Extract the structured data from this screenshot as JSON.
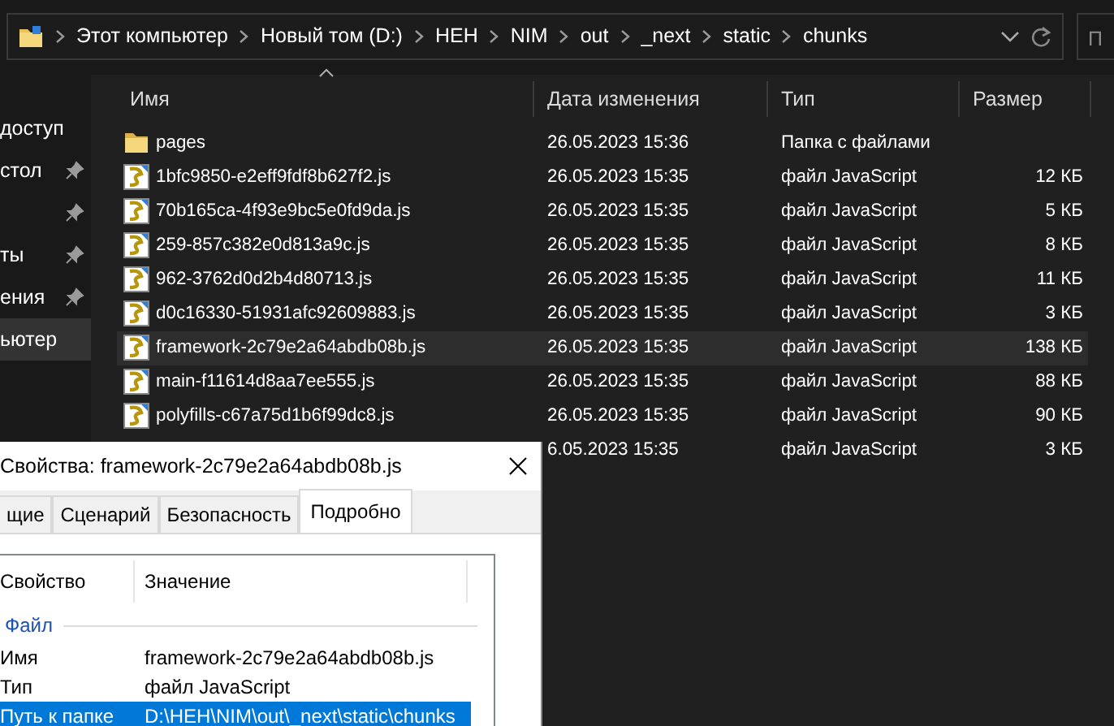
{
  "address_bar": {
    "crumbs": [
      "Этот компьютер",
      "Новый том (D:)",
      "HEH",
      "NIM",
      "out",
      "_next",
      "static",
      "chunks"
    ]
  },
  "search": {
    "placeholder": "П"
  },
  "sidebar": {
    "items": [
      {
        "label": "доступ",
        "pinned": false,
        "selected": false
      },
      {
        "label": "стол",
        "pinned": true,
        "selected": false
      },
      {
        "pinned": true,
        "selected": false
      },
      {
        "label": "ты",
        "pinned": true,
        "selected": false
      },
      {
        "label": "ения",
        "pinned": true,
        "selected": false
      },
      {
        "label": "ьютер",
        "pinned": false,
        "selected": true
      }
    ]
  },
  "file_list": {
    "columns": [
      {
        "label": "Имя",
        "sorted": true
      },
      {
        "label": "Дата изменения",
        "sorted": false
      },
      {
        "label": "Тип",
        "sorted": false
      },
      {
        "label": "Размер",
        "sorted": false
      }
    ],
    "rows": [
      {
        "kind": "folder",
        "name": "pages",
        "date": "26.05.2023 15:36",
        "type": "Папка с файлами",
        "selected": false
      },
      {
        "kind": "script",
        "name": "1bfc9850-e2eff9fdf8b627f2.js",
        "date": "26.05.2023 15:35",
        "type": "файл JavaScript",
        "size": "12 КБ",
        "selected": false
      },
      {
        "kind": "script",
        "name": "70b165ca-4f93e9bc5e0fd9da.js",
        "date": "26.05.2023 15:35",
        "type": "файл JavaScript",
        "size": "5 КБ",
        "selected": false
      },
      {
        "kind": "script",
        "name": "259-857c382e0d813a9c.js",
        "date": "26.05.2023 15:35",
        "type": "файл JavaScript",
        "size": "8 КБ",
        "selected": false
      },
      {
        "kind": "script",
        "name": "962-3762d0d2b4d80713.js",
        "date": "26.05.2023 15:35",
        "type": "файл JavaScript",
        "size": "11 КБ",
        "selected": false
      },
      {
        "kind": "script",
        "name": "d0c16330-51931afc92609883.js",
        "date": "26.05.2023 15:35",
        "type": "файл JavaScript",
        "size": "3 КБ",
        "selected": false
      },
      {
        "kind": "script",
        "name": "framework-2c79e2a64abdb08b.js",
        "date": "26.05.2023 15:35",
        "type": "файл JavaScript",
        "size": "138 КБ",
        "selected": true
      },
      {
        "kind": "script",
        "name": "main-f11614d8aa7ee555.js",
        "date": "26.05.2023 15:35",
        "type": "файл JavaScript",
        "size": "88 КБ",
        "selected": false
      },
      {
        "kind": "script",
        "name": "polyfills-c67a75d1b6f99dc8.js",
        "date": "26.05.2023 15:35",
        "type": "файл JavaScript",
        "size": "90 КБ",
        "selected": false
      },
      {
        "kind": "hidden",
        "date": "6.05.2023 15:35",
        "type": "файл JavaScript",
        "size": "3 КБ",
        "selected": false
      }
    ]
  },
  "dialog": {
    "title": "Свойства: framework-2c79e2a64abdb08b.js",
    "tabs": [
      {
        "label": "щие",
        "selected": false
      },
      {
        "label": "Сценарий",
        "selected": false
      },
      {
        "label": "Безопасность",
        "selected": false
      },
      {
        "label": "Подробно",
        "selected": true
      }
    ],
    "columns": [
      "Свойство",
      "Значение"
    ],
    "group": "Файл",
    "properties": [
      {
        "name": "Имя",
        "value": "framework-2c79e2a64abdb08b.js",
        "selected": false
      },
      {
        "name": "Тип",
        "value": "файл JavaScript",
        "selected": false
      },
      {
        "name": "Путь к папке",
        "value": "D:\\HEH\\NIM\\out\\_next\\static\\chunks",
        "selected": true
      }
    ]
  }
}
